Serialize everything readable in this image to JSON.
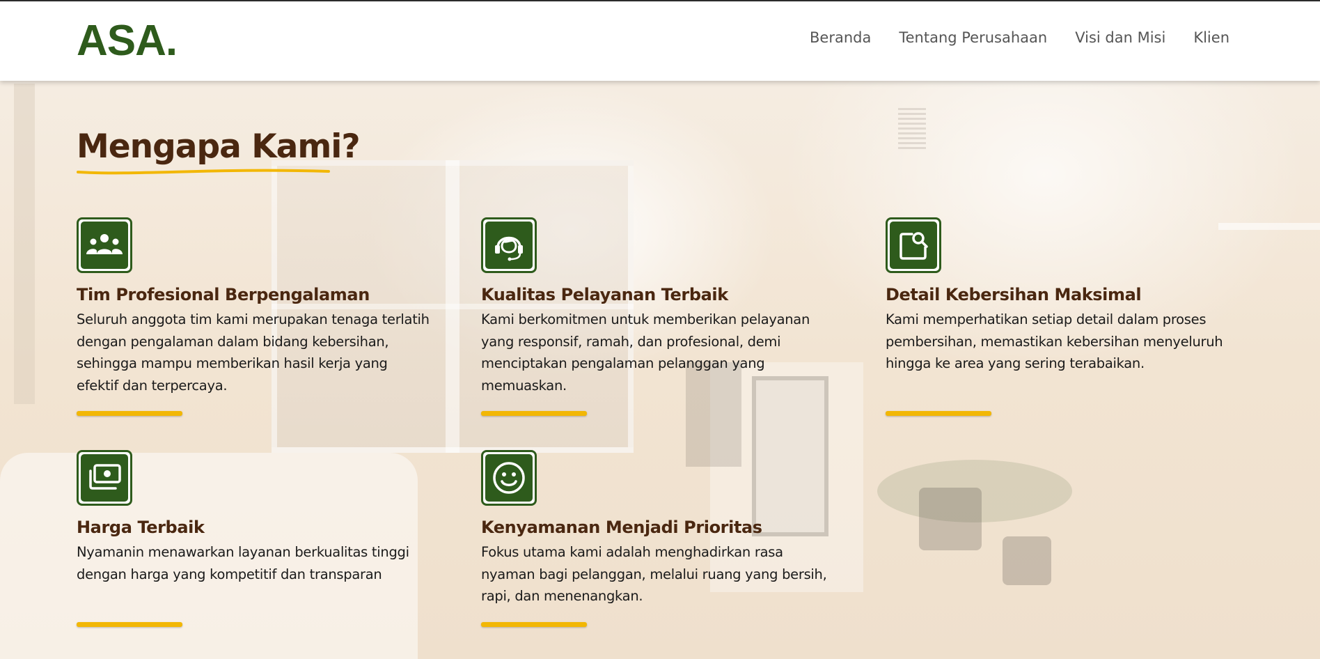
{
  "header": {
    "logo": "ASA.",
    "nav": [
      "Beranda",
      "Tentang Perusahaan",
      "Visi dan Misi",
      "Klien"
    ]
  },
  "section": {
    "title": "Mengapa Kami?"
  },
  "features": [
    {
      "icon": "team-icon",
      "title": "Tim Profesional Berpengalaman",
      "description": "Seluruh anggota tim kami merupakan tenaga terlatih dengan pengalaman dalam bidang kebersihan, sehingga mampu memberikan hasil kerja yang efektif dan terpercaya."
    },
    {
      "icon": "customer-service-icon",
      "title": "Kualitas Pelayanan Terbaik",
      "description": "Kami berkomitmen untuk memberikan pelayanan yang responsif, ramah, dan profesional, demi menciptakan pengalaman pelanggan yang memuaskan."
    },
    {
      "icon": "inspect-search-icon",
      "title": "Detail Kebersihan Maksimal",
      "description": "Kami memperhatikan setiap detail dalam proses pembersihan, memastikan kebersihan menyeluruh hingga ke area yang sering terabaikan."
    },
    {
      "icon": "money-icon",
      "title": "Harga Terbaik",
      "description": "Nyamanin menawarkan layanan berkualitas tinggi dengan harga yang kompetitif dan transparan"
    },
    {
      "icon": "smile-icon",
      "title": "Kenyamanan Menjadi Prioritas",
      "description": "Fokus utama kami adalah menghadirkan rasa nyaman bagi pelanggan, melalui ruang yang bersih, rapi, dan menenangkan."
    }
  ],
  "colors": {
    "brand_green": "#2e5b1c",
    "heading_brown": "#4a2710",
    "accent_yellow": "#f2b705"
  }
}
